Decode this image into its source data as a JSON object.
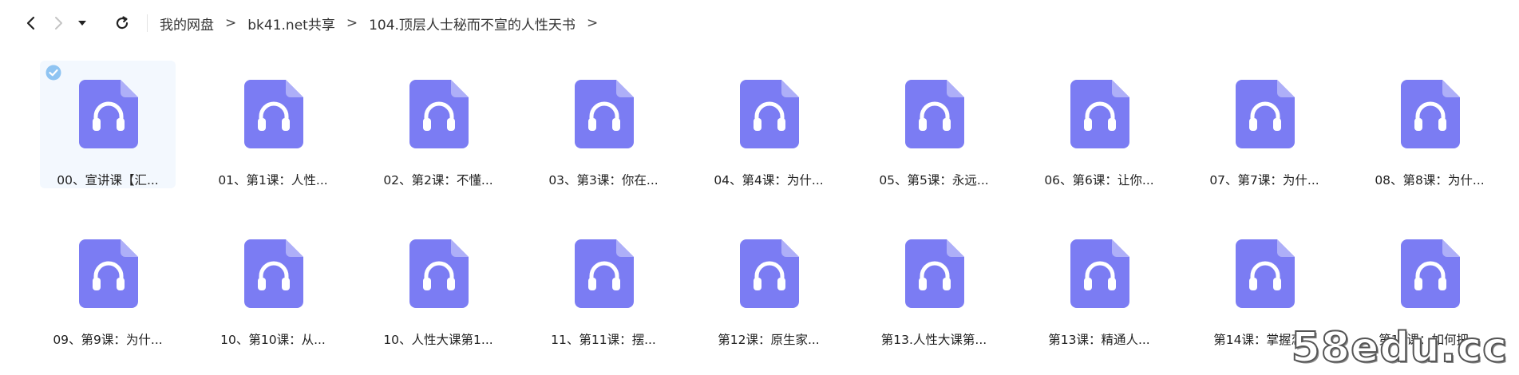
{
  "toolbar": {
    "back_icon": "chevron-left-icon",
    "forward_icon": "chevron-right-icon",
    "dropdown_icon": "caret-down-icon",
    "refresh_icon": "refresh-icon"
  },
  "breadcrumb": [
    "我的网盘",
    "bk41.net共享",
    "104.顶层人士秘而不宣的人性天书"
  ],
  "breadcrumb_sep": ">",
  "icon_color": "#7b7cf3",
  "files": [
    {
      "name": "00、宣讲课【汇...",
      "selected": true
    },
    {
      "name": "01、第1课：人性...",
      "selected": false
    },
    {
      "name": "02、第2课：不懂...",
      "selected": false
    },
    {
      "name": "03、第3课：你在...",
      "selected": false
    },
    {
      "name": "04、第4课：为什...",
      "selected": false
    },
    {
      "name": "05、第5课：永远...",
      "selected": false
    },
    {
      "name": "06、第6课：让你...",
      "selected": false
    },
    {
      "name": "07、第7课：为什...",
      "selected": false
    },
    {
      "name": "08、第8课：为什...",
      "selected": false
    },
    {
      "name": "09、第9课：为什...",
      "selected": false
    },
    {
      "name": "10、第10课：从...",
      "selected": false
    },
    {
      "name": "10、人性大课第1...",
      "selected": false
    },
    {
      "name": "11、第11课：摆...",
      "selected": false
    },
    {
      "name": "第12课：原生家...",
      "selected": false
    },
    {
      "name": "第13.人性大课第...",
      "selected": false
    },
    {
      "name": "第13课：精通人...",
      "selected": false
    },
    {
      "name": "第14课：掌握恋...",
      "selected": false
    },
    {
      "name": "第15课：如何把...",
      "selected": false
    }
  ],
  "watermark": "58edu.cc"
}
